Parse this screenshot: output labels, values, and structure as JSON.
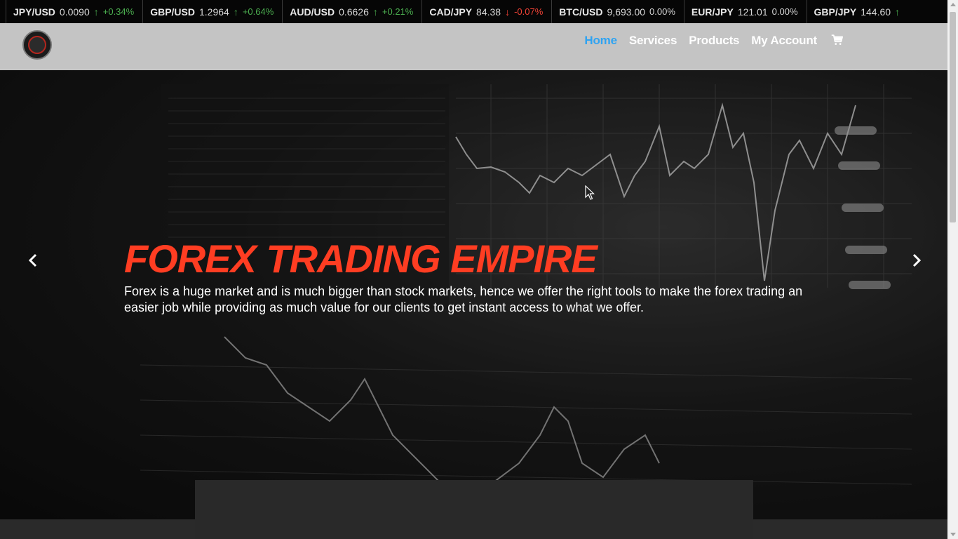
{
  "ticker": [
    {
      "symbol": "JPY/USD",
      "price": "0.0090",
      "direction": "up",
      "change": "+0.34%"
    },
    {
      "symbol": "GBP/USD",
      "price": "1.2964",
      "direction": "up",
      "change": "+0.64%"
    },
    {
      "symbol": "AUD/USD",
      "price": "0.6626",
      "direction": "up",
      "change": "+0.21%"
    },
    {
      "symbol": "CAD/JPY",
      "price": "84.38",
      "direction": "down",
      "change": "-0.07%"
    },
    {
      "symbol": "BTC/USD",
      "price": "9,693.00",
      "direction": "flat",
      "change": "0.00%"
    },
    {
      "symbol": "EUR/JPY",
      "price": "121.01",
      "direction": "flat",
      "change": "0.00%"
    },
    {
      "symbol": "GBP/JPY",
      "price": "144.60",
      "direction": "up",
      "change": ""
    }
  ],
  "nav": {
    "items": [
      {
        "label": "Home",
        "active": true
      },
      {
        "label": "Services",
        "active": false
      },
      {
        "label": "Products",
        "active": false
      },
      {
        "label": "My Account",
        "active": false
      }
    ],
    "cart_icon": "shopping-cart-icon"
  },
  "hero": {
    "title": "FOREX TRADING EMPIRE",
    "text": "Forex is a huge market and is much bigger than stock markets, hence we offer the right tools to make the forex trading an easier job while providing as much value for our clients to get instant access to what we offer.",
    "prev_icon": "chevron-left-icon",
    "next_icon": "chevron-right-icon"
  },
  "colors": {
    "accent": "#ff3d22",
    "nav_active": "#2ea3f2",
    "up": "#4caf50",
    "down": "#f44336"
  }
}
